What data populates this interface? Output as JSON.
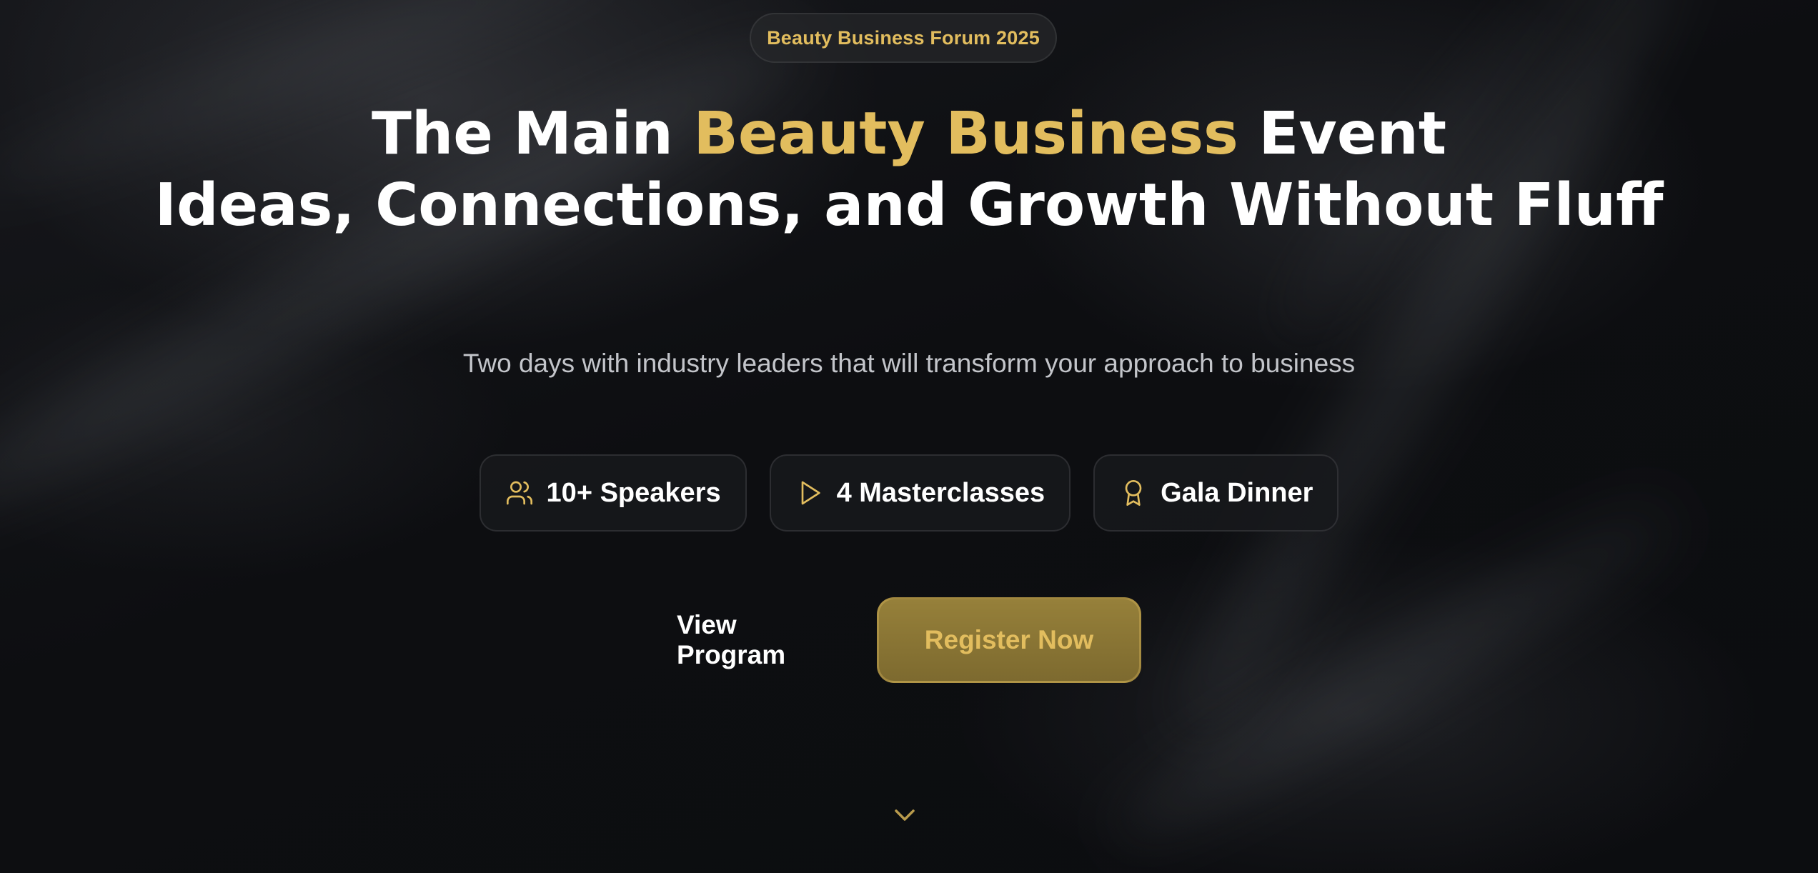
{
  "badge": {
    "label": "Beauty Business Forum 2025"
  },
  "hero": {
    "headline_pre": "The Main ",
    "headline_accent": "Beauty Business",
    "headline_post": " Event",
    "headline_line2": "Ideas, Connections, and Growth Without Fluff",
    "subtitle": "Two days with industry leaders that will transform your approach to business"
  },
  "features": [
    {
      "icon": "users-icon",
      "label": "10+ Speakers"
    },
    {
      "icon": "play-icon",
      "label": "4 Masterclasses"
    },
    {
      "icon": "award-icon",
      "label": "Gala Dinner"
    }
  ],
  "cta": {
    "view_program": "View Program",
    "register": "Register Now"
  },
  "scroll_hint": {
    "icon": "chevron-down-icon"
  },
  "colors": {
    "accent": "#e2bd5e",
    "background": "#0b0c0f",
    "text": "#ffffff",
    "muted_text": "#c3c5ca"
  }
}
